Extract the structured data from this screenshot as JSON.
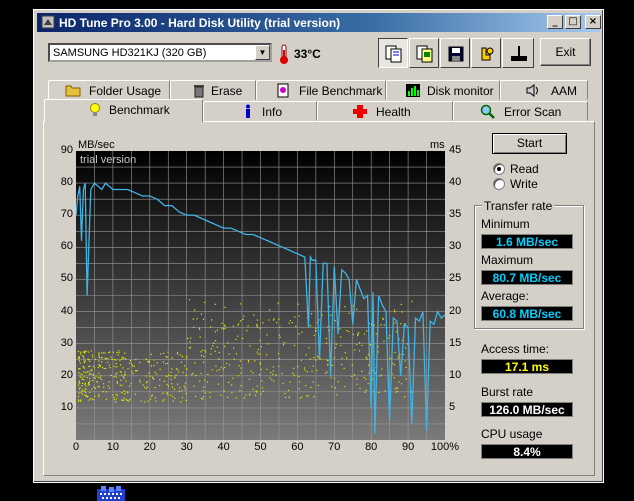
{
  "window": {
    "title": "HD Tune Pro 3.00 - Hard Disk Utility (trial version)",
    "min_glyph": "_",
    "max_glyph": "□",
    "close_glyph": "×"
  },
  "toolbar": {
    "drive_select": "SAMSUNG HD321KJ (320 GB)",
    "temperature": "33°C",
    "exit_label": "Exit",
    "tools": [
      "copy-info-icon",
      "copy-screenshot-icon",
      "save-icon",
      "options-icon",
      "disk-icon"
    ]
  },
  "tabs_row1": [
    {
      "label": "Folder Usage",
      "icon": "folder-icon"
    },
    {
      "label": "Erase",
      "icon": "trash-icon"
    },
    {
      "label": "File Benchmark",
      "icon": "file-benchmark-icon"
    },
    {
      "label": "Disk monitor",
      "icon": "disk-monitor-icon"
    },
    {
      "label": "AAM",
      "icon": "speaker-icon"
    }
  ],
  "tabs_row2": [
    {
      "label": "Benchmark",
      "icon": "lightbulb-icon",
      "active": true
    },
    {
      "label": "Info",
      "icon": "info-icon"
    },
    {
      "label": "Health",
      "icon": "health-icon"
    },
    {
      "label": "Error Scan",
      "icon": "magnifier-icon"
    }
  ],
  "benchmark": {
    "start_label": "Start",
    "read_label": "Read",
    "write_label": "Write",
    "mode_selected": "Read",
    "transfer_rate_title": "Transfer rate",
    "minimum_label": "Minimum",
    "minimum_value": "1.6 MB/sec",
    "maximum_label": "Maximum",
    "maximum_value": "80.7 MB/sec",
    "average_label": "Average:",
    "average_value": "60.8 MB/sec",
    "access_label": "Access time:",
    "access_value": "17.1 ms",
    "burst_label": "Burst rate",
    "burst_value": "126.0 MB/sec",
    "cpu_label": "CPU usage",
    "cpu_value": "8.4%"
  },
  "chart_data": {
    "type": "line",
    "watermark": "trial version",
    "y_left_unit": "MB/sec",
    "y_right_unit": "ms",
    "y_left_ticks": [
      "90",
      "80",
      "70",
      "60",
      "50",
      "40",
      "30",
      "20",
      "10"
    ],
    "y_right_ticks": [
      "45",
      "40",
      "35",
      "30",
      "25",
      "20",
      "15",
      "10",
      "5"
    ],
    "x_ticks": [
      "0",
      "10",
      "20",
      "30",
      "40",
      "50",
      "60",
      "70",
      "80",
      "90",
      "100%"
    ],
    "ylim_left": [
      0,
      90
    ],
    "ylim_right": [
      0,
      45
    ],
    "xlim": [
      0,
      100
    ],
    "grid": true,
    "colors": {
      "transfer": "#3fb4e6",
      "access": "#e6e600",
      "background_top": "#000000",
      "background_bottom": "#7a7a7a"
    },
    "series": [
      {
        "name": "Transfer rate",
        "axis": "left",
        "x": [
          0,
          0.5,
          1,
          1.5,
          2,
          2.5,
          3,
          4,
          5,
          6,
          7,
          8,
          9,
          10,
          12,
          14,
          16,
          18,
          20,
          22,
          24,
          26,
          28,
          30,
          32,
          34,
          36,
          38,
          40,
          42,
          44,
          46,
          48,
          50,
          52,
          54,
          56,
          58,
          60,
          62,
          63,
          63.5,
          64,
          65,
          66,
          67,
          68,
          69,
          70,
          71,
          72,
          73,
          74,
          75,
          76,
          77,
          78,
          79,
          80,
          80.5,
          81,
          82,
          83,
          84,
          85,
          86,
          87,
          88,
          89,
          90,
          91,
          92,
          93,
          94,
          95,
          96,
          97,
          98,
          99,
          100
        ],
        "values": [
          70,
          76,
          79,
          62,
          78,
          80,
          45,
          78,
          80,
          79,
          78,
          80,
          79,
          78,
          78,
          78,
          77,
          76,
          76,
          75,
          73,
          73,
          71,
          70,
          70,
          69,
          68,
          67,
          66,
          66,
          65,
          64,
          64,
          63,
          62,
          61,
          60,
          59,
          58,
          57,
          35,
          57,
          56,
          56,
          25,
          55,
          55,
          20,
          54,
          33,
          53,
          52,
          50,
          36,
          50,
          47,
          44,
          45,
          10,
          46,
          2,
          45,
          42,
          40,
          6,
          38,
          37,
          20,
          36,
          35,
          5,
          38,
          37,
          40,
          3,
          37,
          36,
          40,
          38,
          39
        ]
      },
      {
        "name": "Access time",
        "axis": "right",
        "type": "scatter",
        "note_range_ms": [
          4,
          31
        ]
      }
    ]
  }
}
